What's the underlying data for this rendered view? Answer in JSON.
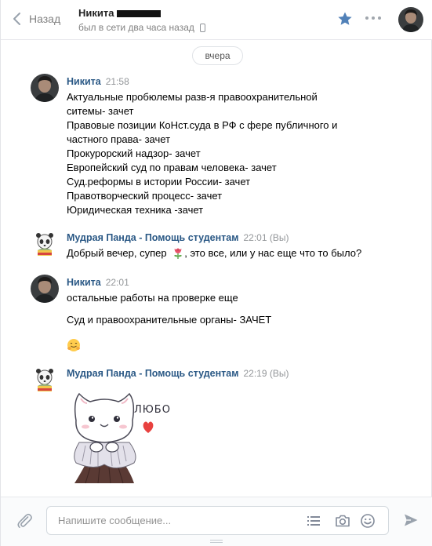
{
  "header": {
    "back_label": "Назад",
    "peer_name": "Никита",
    "peer_status": "был в сети два часа назад"
  },
  "date_separator": "вчера",
  "messages": [
    {
      "author": "Никита",
      "time": "21:58",
      "lines": [
        "Актуальные пробюлемы разв-я правоохранительной",
        "ситемы- зачет",
        "Правовые позиции КоНст.суда в РФ с фере публичного и",
        "частного права- зачет",
        "Прокурорский надзор- зачет",
        "Европейский суд по правам человека- зачет",
        "Суд.реформы в истории России- зачет",
        "Правотворческий процесс- зачет",
        "Юридическая техника -зачет"
      ]
    },
    {
      "author": "Мудрая Панда - Помощь студентам",
      "time": "22:01 (Вы)",
      "text_before": "Добрый вечер, супер",
      "text_after": ", это все, или у нас еще что то было?",
      "emoji": "rose-icon"
    },
    {
      "author": "Никита",
      "time": "22:01",
      "lines": [
        "остальные работы на проверке еще",
        "Суд и правоохранительные органы- ЗАЧЕТ"
      ],
      "emoji": "hugging-face-icon"
    },
    {
      "author": "Мудрая Панда - Помощь студентам",
      "time": "22:19 (Вы)",
      "sticker_text": "ЛЮБО"
    }
  ],
  "composer": {
    "placeholder": "Напишите сообщение..."
  },
  "colors": {
    "author": "#2a5885",
    "star": "#5181b8",
    "muted": "#828282"
  }
}
